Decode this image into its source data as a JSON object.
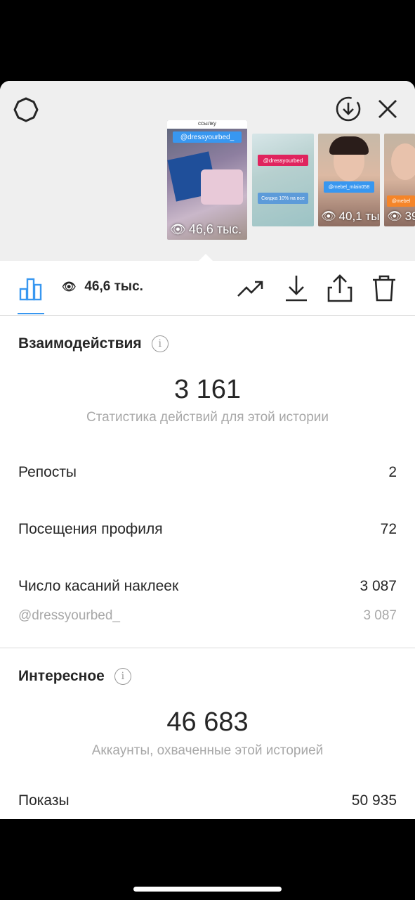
{
  "header": {
    "settings_icon": "gear-icon",
    "download_icon": "download-circle-icon",
    "close_icon": "close-icon"
  },
  "stories": [
    {
      "tag_top": "ссылку",
      "tag": "@dressyourbed_",
      "views": "46,6 тыс.",
      "tag_color": "#3897f0"
    },
    {
      "tag": "@dressyourbed",
      "caption": "Скидка 10% на все",
      "tag_color": "#e0245e"
    },
    {
      "tag": "@mebel_mlain058",
      "views": "40,1 ты",
      "tag_color": "#3897f0"
    },
    {
      "tag": "@mebel",
      "views": "39",
      "tag_color": "#f58529"
    }
  ],
  "toolbar": {
    "views": "46,6 тыс.",
    "icons": [
      "bar-chart-icon",
      "eye-icon",
      "trending-icon",
      "download-icon",
      "share-icon",
      "trash-icon"
    ]
  },
  "interactions": {
    "title": "Взаимодействия",
    "total": "3 161",
    "caption": "Статистика действий для этой истории",
    "rows": [
      {
        "label": "Репосты",
        "value": "2"
      },
      {
        "label": "Посещения профиля",
        "value": "72"
      },
      {
        "label": "Число касаний наклеек",
        "value": "3 087"
      }
    ],
    "sub_row": {
      "label": "@dressyourbed_",
      "value": "3 087"
    }
  },
  "discovery": {
    "title": "Интересное",
    "total": "46 683",
    "caption": "Аккаунты, охваченные этой историей",
    "rows": [
      {
        "label": "Показы",
        "value": "50 935"
      }
    ]
  },
  "colors": {
    "accent": "#3897f0",
    "text": "#262626",
    "secondary": "#a8a8a8"
  }
}
